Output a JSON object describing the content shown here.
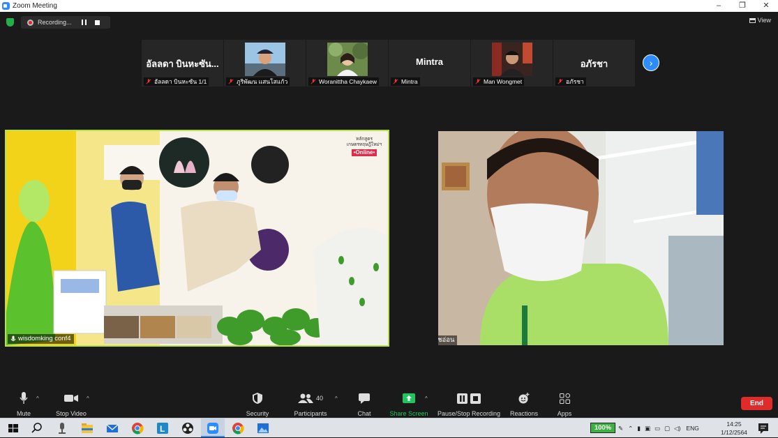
{
  "window": {
    "title": "Zoom Meeting",
    "controls": [
      "–",
      "❐",
      "✕"
    ]
  },
  "recording": {
    "label": "Recording..."
  },
  "view_button": {
    "label": "View"
  },
  "thumbnails": [
    {
      "display": "อัลลดา บินหะซัน...",
      "caption": "อัลลดา บินหะซัน 1/1",
      "has_video": false
    },
    {
      "display": "",
      "caption": "ภูริพัฒน แสนโสแก้ว",
      "has_video": true
    },
    {
      "display": "",
      "caption": "Woranittha Chaykaew",
      "has_video": true
    },
    {
      "display": "Mintra",
      "caption": "Mintra",
      "has_video": false
    },
    {
      "display": "",
      "caption": "Man Wongmet",
      "has_video": true
    },
    {
      "display": "อภัรชา",
      "caption": "อภัรชา",
      "has_video": false
    }
  ],
  "main_videos": [
    {
      "caption": "wisdomking conf4",
      "banner_line1": "หลักสูตร",
      "banner_line2": "เกษตรทฤษฎีใหม่ฯ",
      "banner_badge": "•Online•"
    },
    {
      "caption": "จุฑารัตน์ ธรัชอ่อน"
    }
  ],
  "toolbar": {
    "mute": "Mute",
    "stop_video": "Stop Video",
    "security": "Security",
    "participants": "Participants",
    "participants_count": "40",
    "chat": "Chat",
    "share_screen": "Share Screen",
    "pause_stop_recording": "Pause/Stop Recording",
    "reactions": "Reactions",
    "apps": "Apps",
    "end": "End"
  },
  "taskbar": {
    "zoom_percent": "100%",
    "language": "ENG",
    "time": "14:25",
    "date": "1/12/2564"
  },
  "colors": {
    "accent": "#2d8cff",
    "active_speaker": "#b8e246",
    "share_green": "#21c55d",
    "end_red": "#e02b2b"
  }
}
